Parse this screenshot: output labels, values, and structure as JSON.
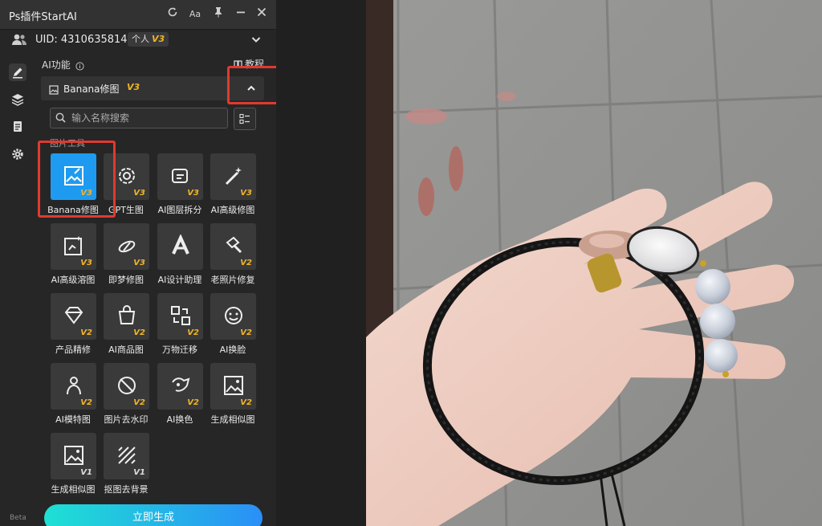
{
  "window": {
    "title": "Ps插件StartAI",
    "font_size_label": "Aa"
  },
  "user": {
    "uid": "UID: 4310635814",
    "plan": "个人",
    "plan_version": "V3"
  },
  "section": {
    "label": "AI功能",
    "tutorial": "教程",
    "title": "Banana修图",
    "version": "V3"
  },
  "search": {
    "placeholder": "输入名称搜索"
  },
  "category": {
    "label": "图片工具"
  },
  "tools": [
    {
      "label": "Banana修图",
      "version": "V3",
      "icon": "image-edit-icon"
    },
    {
      "label": "GPT生图",
      "version": "V3",
      "icon": "openai-icon"
    },
    {
      "label": "AI图层拆分",
      "version": "V3",
      "icon": "layer-split-icon"
    },
    {
      "label": "AI高级修图",
      "version": "V3",
      "icon": "magic-wand-icon"
    },
    {
      "label": "AI高级溶图",
      "version": "V3",
      "icon": "image-blend-icon"
    },
    {
      "label": "即梦修图",
      "version": "V3",
      "icon": "dream-icon"
    },
    {
      "label": "AI设计助理",
      "version": "",
      "icon": "design-assistant-icon"
    },
    {
      "label": "老照片修复",
      "version": "V2",
      "icon": "hammer-icon"
    },
    {
      "label": "产品精修",
      "version": "V2",
      "icon": "diamond-icon"
    },
    {
      "label": "AI商品图",
      "version": "V2",
      "icon": "shopping-bag-icon"
    },
    {
      "label": "万物迁移",
      "version": "V2",
      "icon": "transfer-icon"
    },
    {
      "label": "AI换脸",
      "version": "V2",
      "icon": "face-swap-icon"
    },
    {
      "label": "AI模特图",
      "version": "V2",
      "icon": "model-icon"
    },
    {
      "label": "图片去水印",
      "version": "V2",
      "icon": "no-watermark-icon"
    },
    {
      "label": "AI换色",
      "version": "V2",
      "icon": "recolor-icon"
    },
    {
      "label": "生成相似图",
      "version": "V2",
      "icon": "similar-image-icon"
    },
    {
      "label": "生成相似图",
      "version": "V1",
      "icon": "similar-image-icon"
    },
    {
      "label": "抠图去背景",
      "version": "V1",
      "icon": "remove-bg-icon"
    }
  ],
  "generate": {
    "label": "立即生成"
  },
  "beta": "Beta",
  "colors": {
    "accent": "#1e9bf0",
    "highlight": "#e03a2f",
    "version": "#f0b429"
  }
}
